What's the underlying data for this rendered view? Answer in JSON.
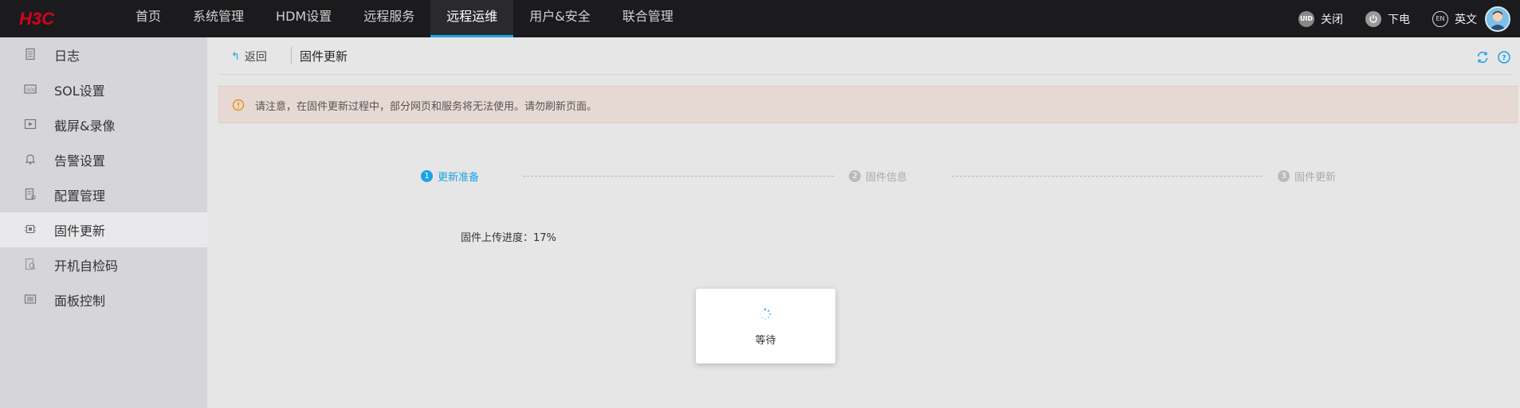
{
  "brand": {
    "logo_text": "H3C",
    "logo_color": "#d7001a"
  },
  "nav": {
    "items": [
      {
        "label": "首页",
        "active": false
      },
      {
        "label": "系统管理",
        "active": false
      },
      {
        "label": "HDM设置",
        "active": false
      },
      {
        "label": "远程服务",
        "active": false
      },
      {
        "label": "远程运维",
        "active": true
      },
      {
        "label": "用户&安全",
        "active": false
      },
      {
        "label": "联合管理",
        "active": false
      }
    ],
    "uid_label": "关闭",
    "uid_icon_text": "UID",
    "power_label": "下电",
    "lang_icon_text": "EN",
    "lang_label": "英文",
    "accent_color": "#1aa3e6"
  },
  "sidebar": {
    "items": [
      {
        "label": "日志",
        "icon": "log-icon",
        "active": false
      },
      {
        "label": "SOL设置",
        "icon": "sol-icon",
        "active": false
      },
      {
        "label": "截屏&录像",
        "icon": "video-icon",
        "active": false
      },
      {
        "label": "告警设置",
        "icon": "bell-icon",
        "active": false
      },
      {
        "label": "配置管理",
        "icon": "config-icon",
        "active": false
      },
      {
        "label": "固件更新",
        "icon": "chip-icon",
        "active": true
      },
      {
        "label": "开机自检码",
        "icon": "post-code-icon",
        "active": false
      },
      {
        "label": "面板控制",
        "icon": "panel-icon",
        "active": false
      }
    ]
  },
  "breadcrumb": {
    "back_label": "返回",
    "title": "固件更新"
  },
  "notice": {
    "text": "请注意，在固件更新过程中，部分网页和服务将无法使用。请勿刷新页面。"
  },
  "steps": [
    {
      "num": "1",
      "label": "更新准备",
      "active": true
    },
    {
      "num": "2",
      "label": "固件信息",
      "active": false
    },
    {
      "num": "3",
      "label": "固件更新",
      "active": false
    }
  ],
  "progress": {
    "label": "固件上传进度：",
    "value_text": "17%",
    "value": 17
  },
  "modal": {
    "text": "等待"
  }
}
